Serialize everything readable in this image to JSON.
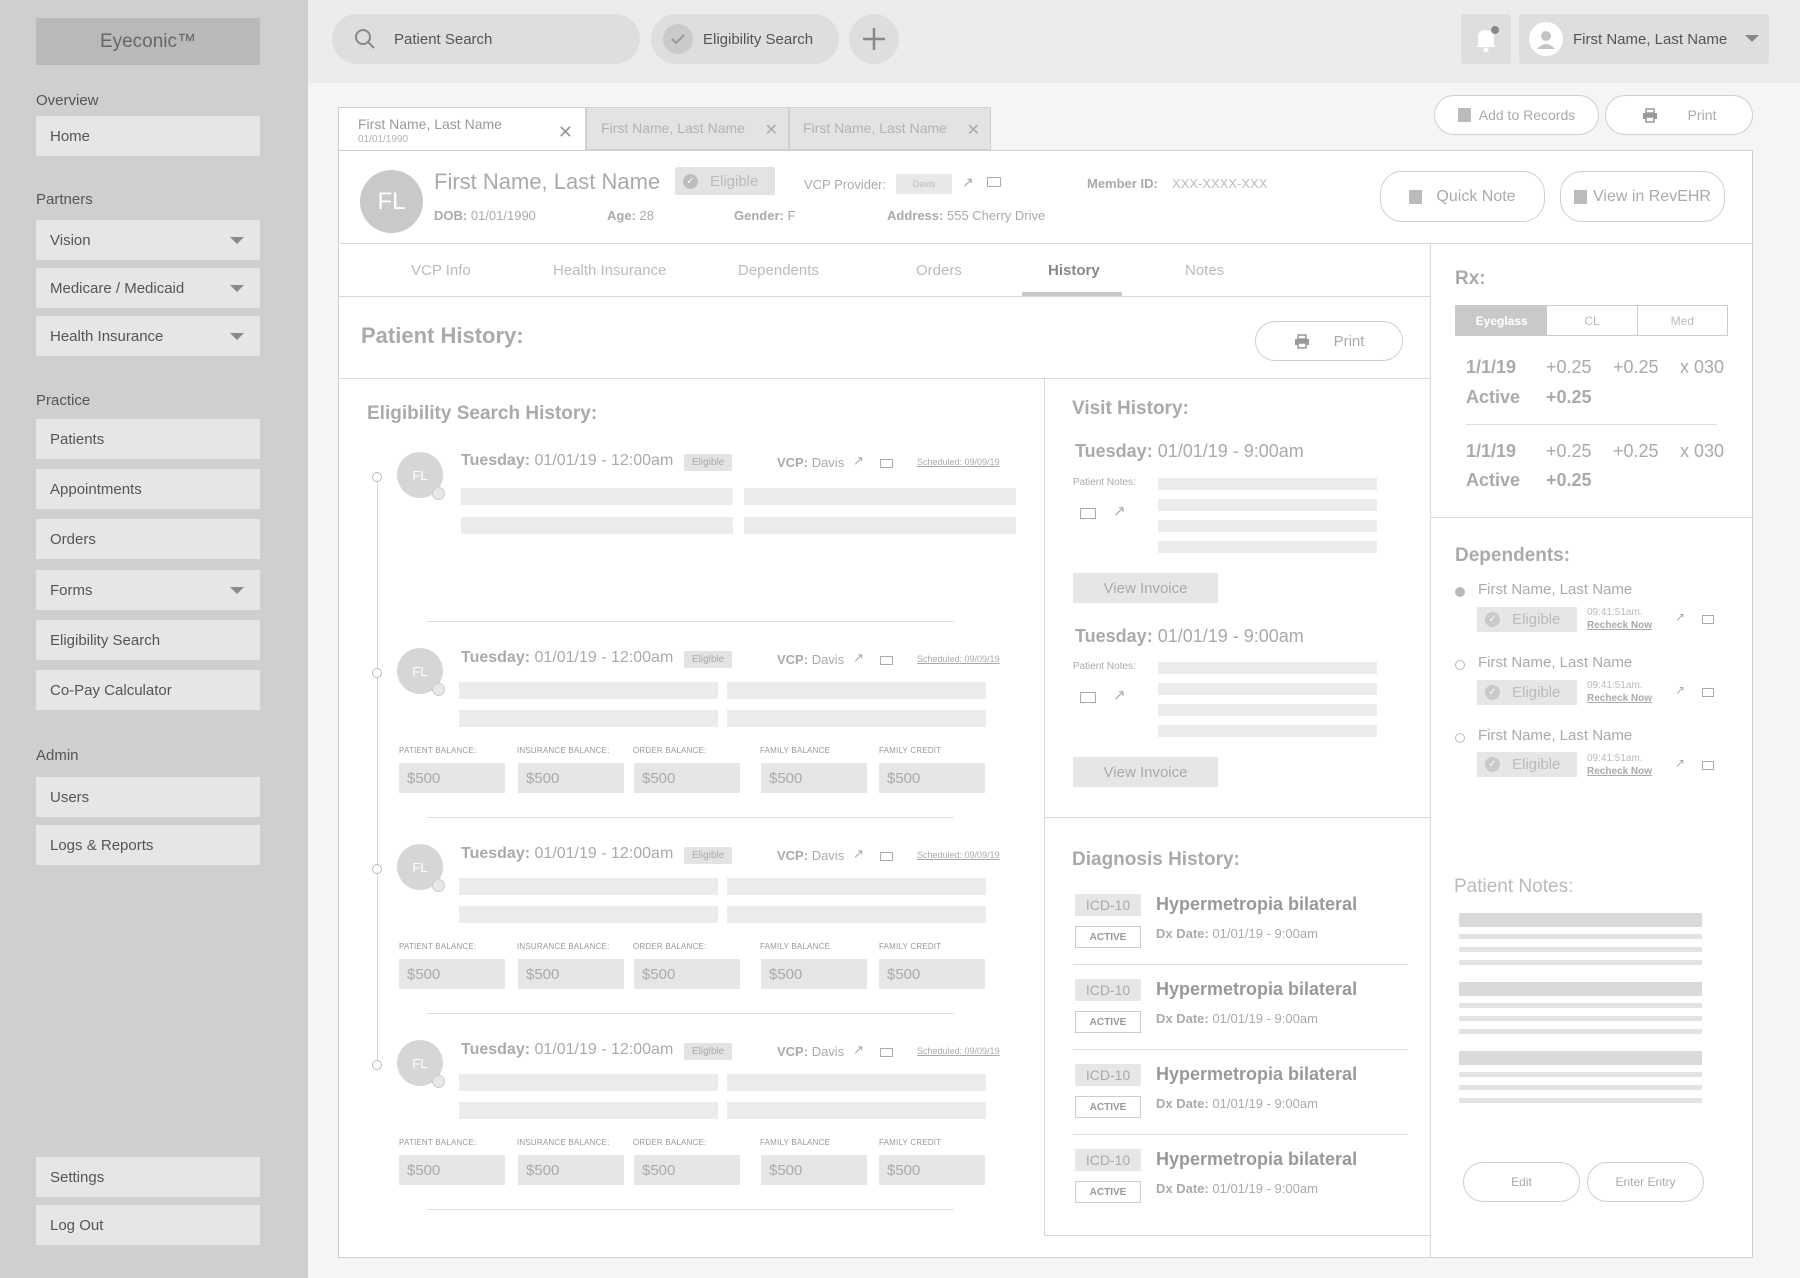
{
  "app": {
    "logo": "Eyeconic™"
  },
  "sidebar": {
    "overview_label": "Overview",
    "home": "Home",
    "partners_label": "Partners",
    "partners": [
      "Vision",
      "Medicare / Medicaid",
      "Health Insurance"
    ],
    "practice_label": "Practice",
    "practice": [
      "Patients",
      "Appointments",
      "Orders",
      "Forms",
      "Eligibility Search",
      "Co-Pay Calculator"
    ],
    "admin_label": "Admin",
    "admin": [
      "Users",
      "Logs & Reports"
    ],
    "settings": "Settings",
    "logout": "Log Out"
  },
  "topbar": {
    "patient_search": "Patient Search",
    "eligibility_search": "Eligibility Search",
    "user_name": "First Name, Last Name"
  },
  "patient_tabs": [
    {
      "name": "First Name, Last Name",
      "dob": "01/01/1990"
    },
    {
      "name": "First Name, Last Name"
    },
    {
      "name": "First Name, Last Name"
    }
  ],
  "actions": {
    "add_to_records": "Add to Records",
    "print": "Print"
  },
  "patient": {
    "initials": "FL",
    "name": "First Name, Last Name",
    "status": "Eligible",
    "vcp_provider_label": "VCP Provider:",
    "vcp_provider": "Davis",
    "member_id_label": "Member ID:",
    "member_id": "XXX-XXXX-XXX",
    "dob_label": "DOB:",
    "dob": "01/01/1990",
    "age_label": "Age:",
    "age": "28",
    "gender_label": "Gender:",
    "gender": "F",
    "address_label": "Address:",
    "address": "555 Cherry Drive",
    "quick_note": "Quick Note",
    "view_in_revehr": "View in RevEHR"
  },
  "section_tabs": [
    "VCP Info",
    "Health Insurance",
    "Dependents",
    "Orders",
    "History",
    "Notes"
  ],
  "active_section_tab": "History",
  "history": {
    "title": "Patient History:",
    "print": "Print",
    "eligibility_title": "Eligibility Search History:",
    "entries": [
      {
        "initials": "FL",
        "day": "Tuesday:",
        "datetime": "01/01/19 - 12:00am",
        "status": "Eligible",
        "vcp_label": "VCP:",
        "vcp": "Davis",
        "scheduled": "Scheduled: 09/09/19"
      },
      {
        "initials": "FL",
        "day": "Tuesday:",
        "datetime": "01/01/19 - 12:00am",
        "status": "Eligible",
        "vcp_label": "VCP:",
        "vcp": "Davis",
        "scheduled": "Scheduled: 09/09/19"
      },
      {
        "initials": "FL",
        "day": "Tuesday:",
        "datetime": "01/01/19 - 12:00am",
        "status": "Eligible",
        "vcp_label": "VCP:",
        "vcp": "Davis",
        "scheduled": "Scheduled: 09/09/19"
      },
      {
        "initials": "FL",
        "day": "Tuesday:",
        "datetime": "01/01/19 - 12:00am",
        "status": "Eligible",
        "vcp_label": "VCP:",
        "vcp": "Davis",
        "scheduled": "Scheduled: 09/09/19"
      }
    ],
    "balance_labels": [
      "PATIENT BALANCE:",
      "INSURANCE BALANCE:",
      "ORDER BALANCE:",
      "FAMILY BALANCE",
      "FAMILY CREDIT"
    ],
    "balance_value": "$500",
    "visit_title": "Visit History:",
    "visits": [
      {
        "day": "Tuesday:",
        "datetime": "01/01/19 - 9:00am",
        "notes_label": "Patient Notes:",
        "invoice": "View Invoice"
      },
      {
        "day": "Tuesday:",
        "datetime": "01/01/19 - 9:00am",
        "notes_label": "Patient Notes:",
        "invoice": "View Invoice"
      }
    ],
    "diagnosis_title": "Diagnosis History:",
    "diagnoses": [
      {
        "code": "ICD-10",
        "status": "ACTIVE",
        "name": "Hypermetropia bilateral",
        "date_label": "Dx Date:",
        "date": "01/01/19 - 9:00am"
      },
      {
        "code": "ICD-10",
        "status": "ACTIVE",
        "name": "Hypermetropia bilateral",
        "date_label": "Dx Date:",
        "date": "01/01/19 - 9:00am"
      },
      {
        "code": "ICD-10",
        "status": "ACTIVE",
        "name": "Hypermetropia bilateral",
        "date_label": "Dx Date:",
        "date": "01/01/19 - 9:00am"
      },
      {
        "code": "ICD-10",
        "status": "ACTIVE",
        "name": "Hypermetropia bilateral",
        "date_label": "Dx Date:",
        "date": "01/01/19 - 9:00am"
      }
    ]
  },
  "rx": {
    "title": "Rx:",
    "tabs": [
      "Eyeglass",
      "CL",
      "Med"
    ],
    "active_tab": "Eyeglass",
    "rows": [
      {
        "date": "1/1/19",
        "v1": "+0.25",
        "v2": "+0.25",
        "axis": "x 030",
        "status": "Active",
        "add": "+0.25"
      },
      {
        "date": "1/1/19",
        "v1": "+0.25",
        "v2": "+0.25",
        "axis": "x 030",
        "status": "Active",
        "add": "+0.25"
      }
    ]
  },
  "dependents": {
    "title": "Dependents:",
    "items": [
      {
        "name": "First Name, Last Name",
        "status": "Eligible",
        "time": "09:41:51am.",
        "recheck": "Recheck Now"
      },
      {
        "name": "First Name, Last Name",
        "status": "Eligible",
        "time": "09:41:51am.",
        "recheck": "Recheck Now"
      },
      {
        "name": "First Name, Last Name",
        "status": "Eligible",
        "time": "09:41:51am.",
        "recheck": "Recheck Now"
      }
    ]
  },
  "patient_notes": {
    "title": "Patient Notes:",
    "edit": "Edit",
    "enter_entry": "Enter Entry"
  },
  "colors": {
    "sidebar": "#cfcfcf",
    "topbar": "#ececec",
    "panel": "#ffffff",
    "muted_text": "#8a8a8a",
    "placeholder_bar": "#ececec"
  }
}
